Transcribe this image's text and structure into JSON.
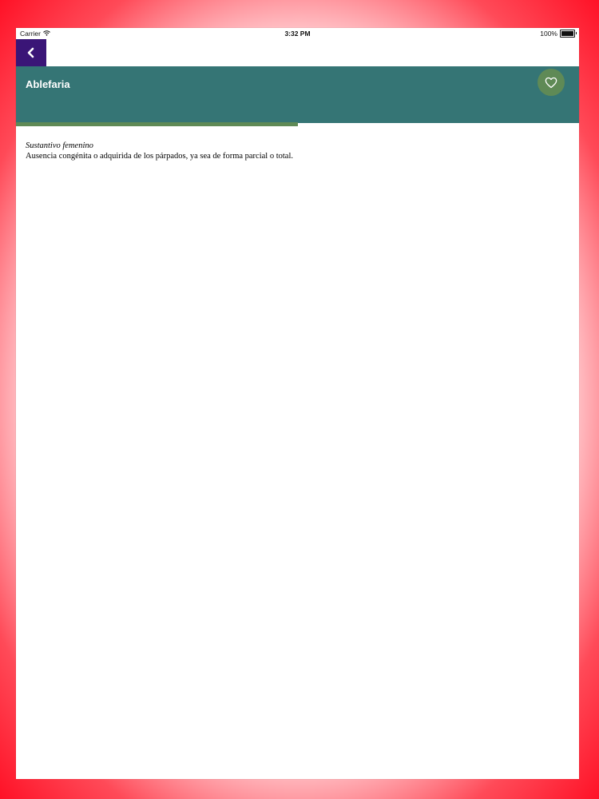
{
  "status_bar": {
    "carrier": "Carrier",
    "time": "3:32 PM",
    "battery": "100%",
    "battery_level": 1.0,
    "wifi_icon": "wifi-icon"
  },
  "nav": {
    "back_icon": "chevron-left-icon",
    "back_button_color": "#3a1577"
  },
  "header": {
    "title": "Ablefaria",
    "background_color": "#357575",
    "favorite_icon": "heart-outline-icon",
    "favorite_button_color": "#5f8a56"
  },
  "progress": {
    "value": 0.5,
    "color": "#5f8a56"
  },
  "entry": {
    "category": "Sustantivo femenino",
    "definition": "Ausencia congénita o adquirida de los párpados, ya sea de forma parcial o total."
  }
}
